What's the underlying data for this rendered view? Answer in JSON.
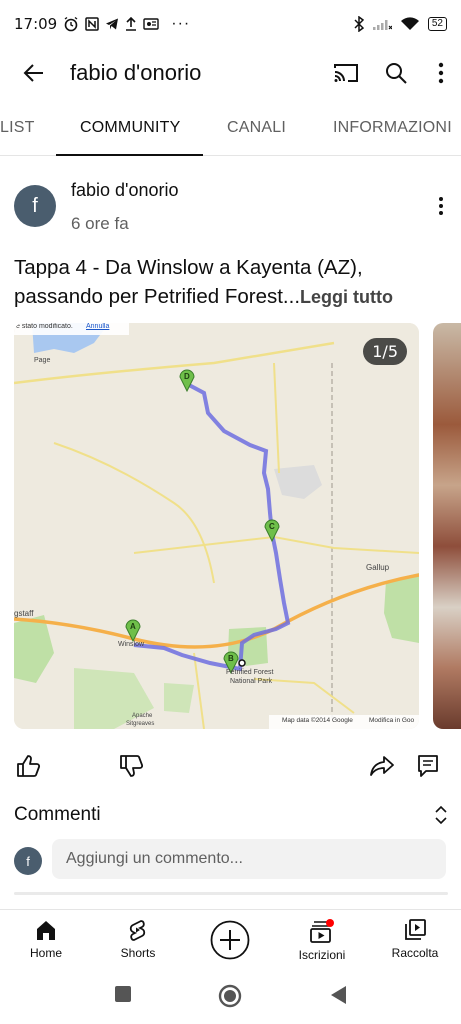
{
  "status": {
    "time": "17:09",
    "left_icons": [
      "alarm-icon",
      "nfc-icon",
      "telegram-icon",
      "upload-icon",
      "photo-icon",
      "more-icon"
    ],
    "more": "···",
    "battery": "52"
  },
  "app_bar": {
    "title": "fabio d'onorio"
  },
  "tabs": [
    {
      "label": "LIST",
      "active": false
    },
    {
      "label": "COMMUNITY",
      "active": true
    },
    {
      "label": "CANALI",
      "active": false
    },
    {
      "label": "INFORMAZIONI",
      "active": false
    }
  ],
  "post": {
    "avatar_letter": "f",
    "author": "fabio d'onorio",
    "time": "6 ore fa",
    "text": "Tappa 4 - Da Winslow a Kayenta (AZ), passando per Petrified Forest...",
    "read_more": "Leggi tutto",
    "image_counter": "1/5",
    "map_labels": {
      "notice": "è stato modificato.",
      "undo": "Annulla",
      "attribution": "Map data ©2014 Google",
      "modify": "Modifica in Goo",
      "place_page": "Page",
      "place_gallup": "Gallup",
      "place_flagstaff": "gstaff",
      "place_winslow": "Winslow",
      "place_petrified": "Petrified Forest",
      "place_park": "National Park",
      "place_apache": "Apache",
      "place_sitgreaves": "Sitgreaves",
      "marker_a": "A",
      "marker_b": "B",
      "marker_c": "C",
      "marker_d": "D"
    }
  },
  "comments": {
    "title": "Commenti",
    "avatar_letter": "f",
    "placeholder": "Aggiungi un commento..."
  },
  "bottom_nav": [
    {
      "label": "Home",
      "icon": "home-icon"
    },
    {
      "label": "Shorts",
      "icon": "shorts-icon"
    },
    {
      "label": "",
      "icon": "create-icon"
    },
    {
      "label": "Iscrizioni",
      "icon": "subscriptions-icon"
    },
    {
      "label": "Raccolta",
      "icon": "library-icon"
    }
  ],
  "colors": {
    "accent_notification": "#ff0000",
    "route": "#6d6ee0",
    "avatar_bg": "#4a5d6e"
  }
}
